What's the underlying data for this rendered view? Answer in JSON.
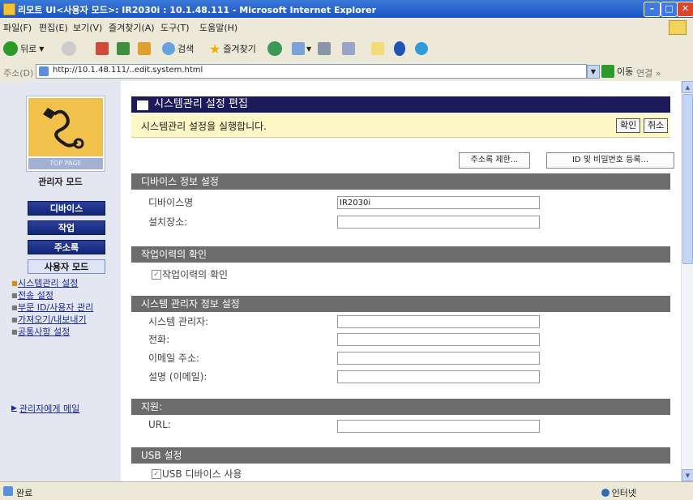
{
  "window": {
    "title": "리모트 UI<사용자 모드>: IR2030i : 10.1.48.111 - Microsoft Internet Explorer"
  },
  "menubar": {
    "items": [
      "파일(F)",
      "편집(E)",
      "보기(V)",
      "즐겨찾기(A)",
      "도구(T)",
      "도움말(H)"
    ]
  },
  "toolbar": {
    "back_label": "뒤로",
    "search_label": "검색",
    "favorites_label": "즐겨찾기"
  },
  "address": {
    "label": "주소(D)",
    "url": "http://10.1.48.111/..edit.system.html",
    "go_label": "이동",
    "links_label": "연결 »"
  },
  "sidebar": {
    "logo_label": "TOP PAGE",
    "mode_title": "관리자 모드",
    "nav": [
      "디바이스",
      "작업",
      "주소록",
      "사용자 모드"
    ],
    "links": [
      "시스템관리 설정",
      "전송 설정",
      "부문 ID/사용자 관리",
      "가져오기/내보내기",
      "공통사항 설정"
    ],
    "back_link": "관리자에게 메일"
  },
  "content": {
    "page_title": "시스템관리 설정 편집",
    "info_message": "시스템관리 설정을 실행합니다.",
    "ok_button": "확인",
    "cancel_button": "취소",
    "address_limit_button": "주소록 제한...",
    "id_password_button": "ID 및 비밀번호 등록...",
    "sections": {
      "device": {
        "title": "디바이스 정보 설정",
        "device_name_label": "디바이스명",
        "device_name_value": "IR2030i",
        "location_label": "설치장소:",
        "location_value": ""
      },
      "job_log": {
        "title": "작업이력의 확인",
        "checkbox_label": "작업이력의 확인",
        "checked": true
      },
      "sysadmin": {
        "title": "시스템 관리자 정보 설정",
        "admin_label": "시스템 관리자:",
        "phone_label": "전화:",
        "email_label": "이메일 주소:",
        "comment_label": "설명 (이메일):"
      },
      "support": {
        "title": "지원:",
        "url_label": "URL:"
      },
      "usb": {
        "title": "USB 설정",
        "checkbox_label": "USB 디바이스 사용",
        "checked": true
      }
    }
  },
  "status": {
    "left_text": "완료",
    "zone_text": "인터넷"
  }
}
